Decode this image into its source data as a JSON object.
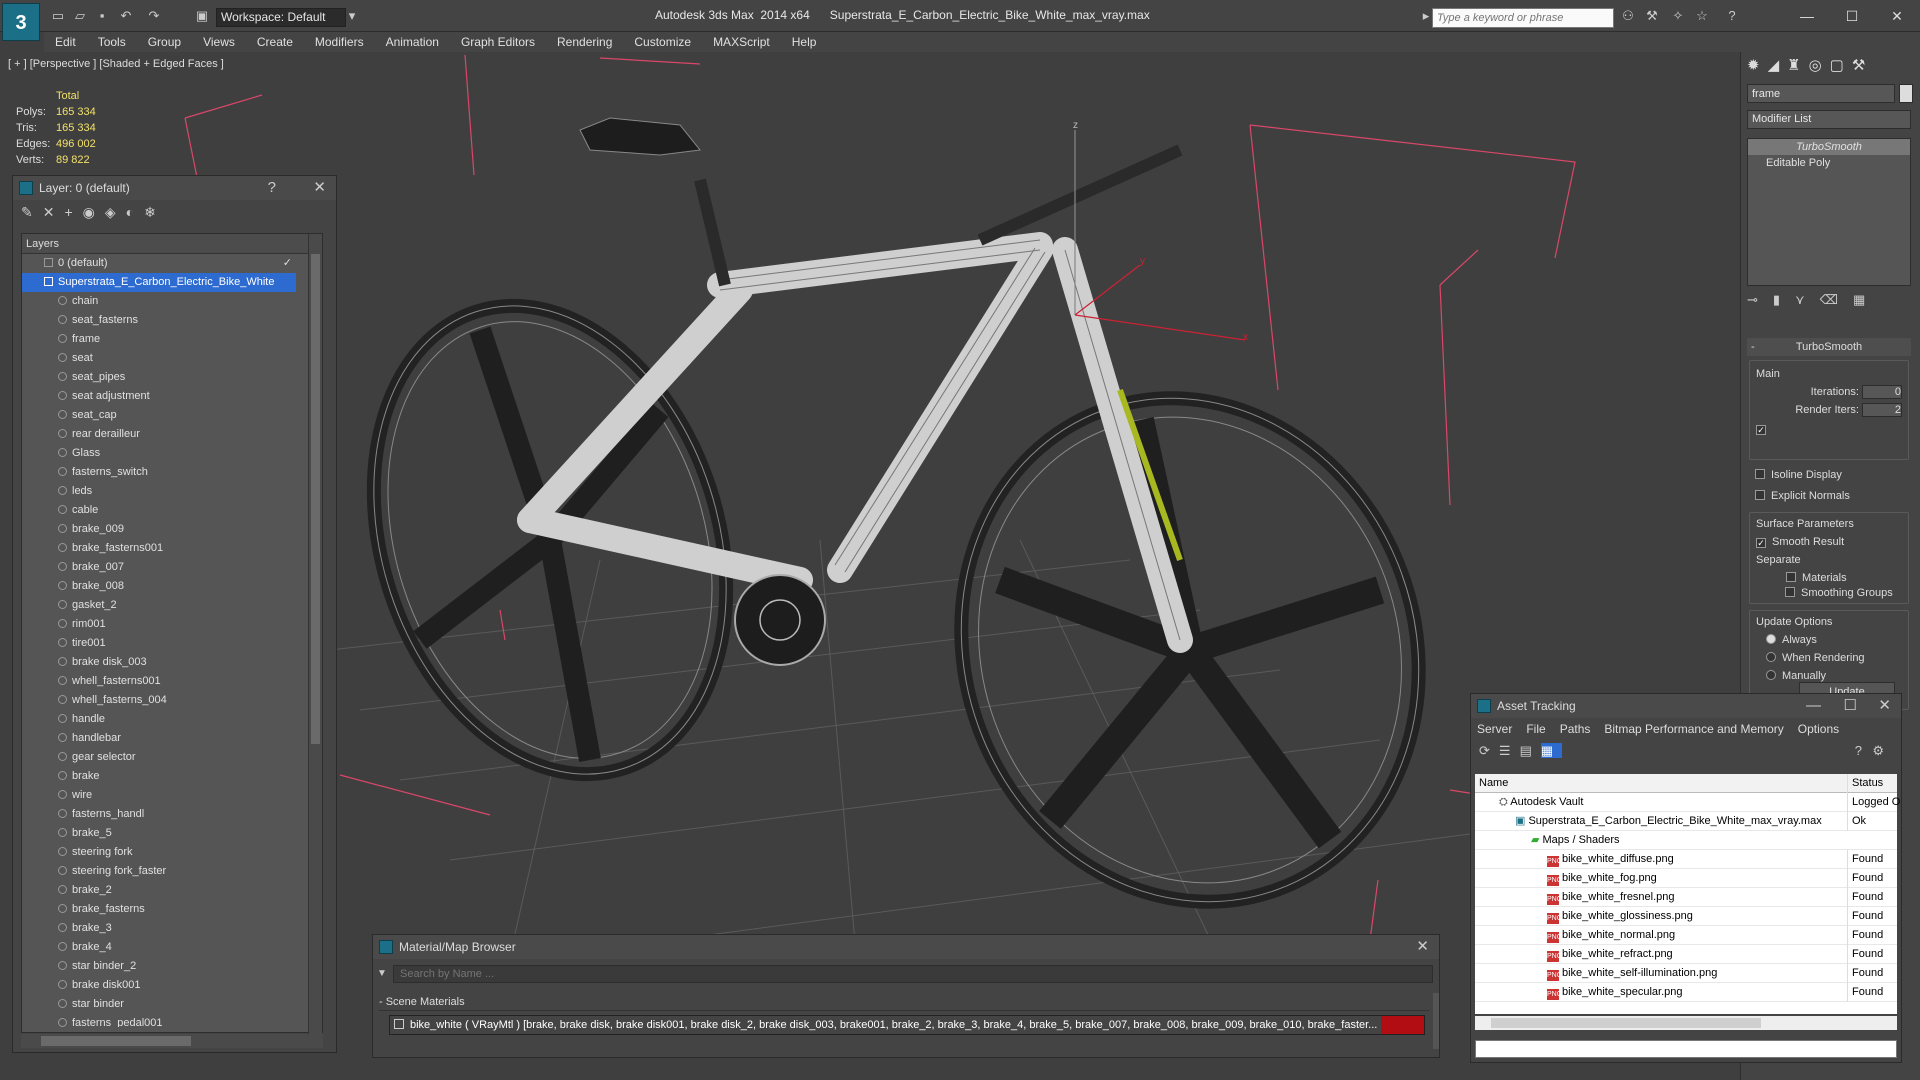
{
  "titlebar": {
    "app": "Autodesk 3ds Max  2014 x64",
    "file": "Superstrata_E_Carbon_Electric_Bike_White_max_vray.max",
    "workspace": "Workspace: Default",
    "search_placeholder": "Type a keyword or phrase"
  },
  "menu": [
    "Edit",
    "Tools",
    "Group",
    "Views",
    "Create",
    "Modifiers",
    "Animation",
    "Graph Editors",
    "Rendering",
    "Customize",
    "MAXScript",
    "Help"
  ],
  "viewport": {
    "label": "[ + ] [Perspective ] [Shaded + Edged Faces ]",
    "stats_header": "Total",
    "stats": [
      {
        "k": "Polys:",
        "v": "165 334"
      },
      {
        "k": "Tris:",
        "v": "165 334"
      },
      {
        "k": "Edges:",
        "v": "496 002"
      },
      {
        "k": "Verts:",
        "v": "89 822"
      }
    ],
    "axis_x": "x",
    "axis_y": "y",
    "axis_z": "z"
  },
  "layer_panel": {
    "title": "Layer: 0 (default)",
    "help": "?",
    "header": "Layers",
    "default_layer": "0 (default)",
    "selected_layer": "Superstrata_E_Carbon_Electric_Bike_White",
    "objects": [
      "chain",
      "seat_fasterns",
      "frame",
      "seat",
      "seat_pipes",
      "seat adjustment",
      "seat_cap",
      "rear derailleur",
      "Glass",
      "fasterns_switch",
      "leds",
      "cable",
      "brake_009",
      "brake_fasterns001",
      "brake_007",
      "brake_008",
      "gasket_2",
      "rim001",
      "tire001",
      "brake disk_003",
      "whell_fasterns001",
      "whell_fasterns_004",
      "handle",
      "handlebar",
      "gear selector",
      "brake",
      "wire",
      "fasterns_handl",
      "brake_5",
      "steering fork",
      "steering fork_faster",
      "brake_2",
      "brake_fasterns",
      "brake_3",
      "brake_4",
      "star binder_2",
      "brake disk001",
      "star binder",
      "fasterns_pedal001"
    ]
  },
  "command_panel": {
    "object_name": "frame",
    "modifier_list": "Modifier List",
    "stack": [
      "TurboSmooth",
      "Editable Poly"
    ],
    "rollout_title": "TurboSmooth",
    "main_label": "Main",
    "iterations_label": "Iterations:",
    "iterations": "0",
    "render_iters_label": "Render Iters:",
    "render_iters": "2",
    "isoline": "Isoline Display",
    "explicit": "Explicit Normals",
    "surface_label": "Surface Parameters",
    "smooth_result": "Smooth Result",
    "separate_label": "Separate",
    "materials": "Materials",
    "smoothing_groups": "Smoothing Groups",
    "update_options": "Update Options",
    "always": "Always",
    "when_rendering": "When Rendering",
    "manually": "Manually",
    "update": "Update"
  },
  "asset_tracking": {
    "title": "Asset Tracking",
    "menu": [
      "Server",
      "File",
      "Paths",
      "Bitmap Performance and Memory",
      "Options"
    ],
    "col_name": "Name",
    "col_status": "Status",
    "vault": {
      "name": "Autodesk Vault",
      "status": "Logged O"
    },
    "scene": {
      "name": "Superstrata_E_Carbon_Electric_Bike_White_max_vray.max",
      "status": "Ok"
    },
    "maps_label": "Maps / Shaders",
    "maps": [
      {
        "name": "bike_white_diffuse.png",
        "status": "Found"
      },
      {
        "name": "bike_white_fog.png",
        "status": "Found"
      },
      {
        "name": "bike_white_fresnel.png",
        "status": "Found"
      },
      {
        "name": "bike_white_glossiness.png",
        "status": "Found"
      },
      {
        "name": "bike_white_normal.png",
        "status": "Found"
      },
      {
        "name": "bike_white_refract.png",
        "status": "Found"
      },
      {
        "name": "bike_white_self-illumination.png",
        "status": "Found"
      },
      {
        "name": "bike_white_specular.png",
        "status": "Found"
      }
    ]
  },
  "material_browser": {
    "title": "Material/Map Browser",
    "search_placeholder": "Search by Name ...",
    "section": "- Scene Materials",
    "material": "bike_white  ( VRayMtl )  [brake, brake disk, brake disk001, brake disk_2, brake disk_003, brake001, brake_2, brake_3, brake_4, brake_5, brake_007, brake_008, brake_009, brake_010, brake_faster..."
  },
  "colors": {
    "accent": "#2d6bd0",
    "stats": "#f3e06a",
    "bbox": "#d9476a",
    "bg": "#3f3f3f"
  }
}
